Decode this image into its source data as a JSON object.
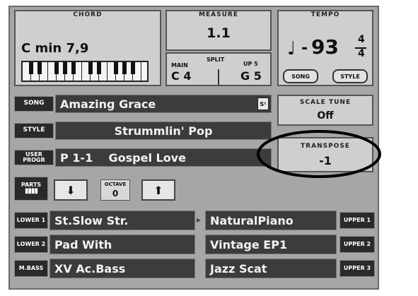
{
  "chord": {
    "label": "CHORD",
    "value": "C min 7,9"
  },
  "measure": {
    "label": "MEASURE",
    "value": "1.1"
  },
  "split": {
    "label": "SPLIT",
    "main_label": "MAIN",
    "main_value": "C 4",
    "up_label": "UP 5",
    "up_value": "G 5"
  },
  "tempo": {
    "label": "TEMPO",
    "value": "93",
    "time_sig_top": "4",
    "time_sig_bottom": "4",
    "song_btn": "SONG",
    "style_btn": "STYLE"
  },
  "song": {
    "tag": "SONG",
    "value": "Amazing Grace",
    "icon_label": "S¹"
  },
  "scale_tune": {
    "label": "SCALE TUNE",
    "value": "Off"
  },
  "style": {
    "tag": "STYLE",
    "value": "Strummlin' Pop"
  },
  "user_program": {
    "tag": "USER PROGR",
    "value": "P 1-1    Gospel Love"
  },
  "transpose": {
    "label": "TRANSPOSE",
    "value": "-1"
  },
  "octave": {
    "parts_label": "PARTS",
    "label": "OCTAVE",
    "value": "0"
  },
  "parts_left": [
    {
      "tag": "LOWER 1",
      "value": "St.Slow Str."
    },
    {
      "tag": "LOWER 2",
      "value": "Pad With"
    },
    {
      "tag": "M.BASS",
      "value": "XV Ac.Bass"
    }
  ],
  "parts_right": [
    {
      "tag": "UPPER 1",
      "value": "NaturalPiano"
    },
    {
      "tag": "UPPER 2",
      "value": "Vintage EP1"
    },
    {
      "tag": "UPPER 3",
      "value": "Jazz Scat"
    }
  ]
}
